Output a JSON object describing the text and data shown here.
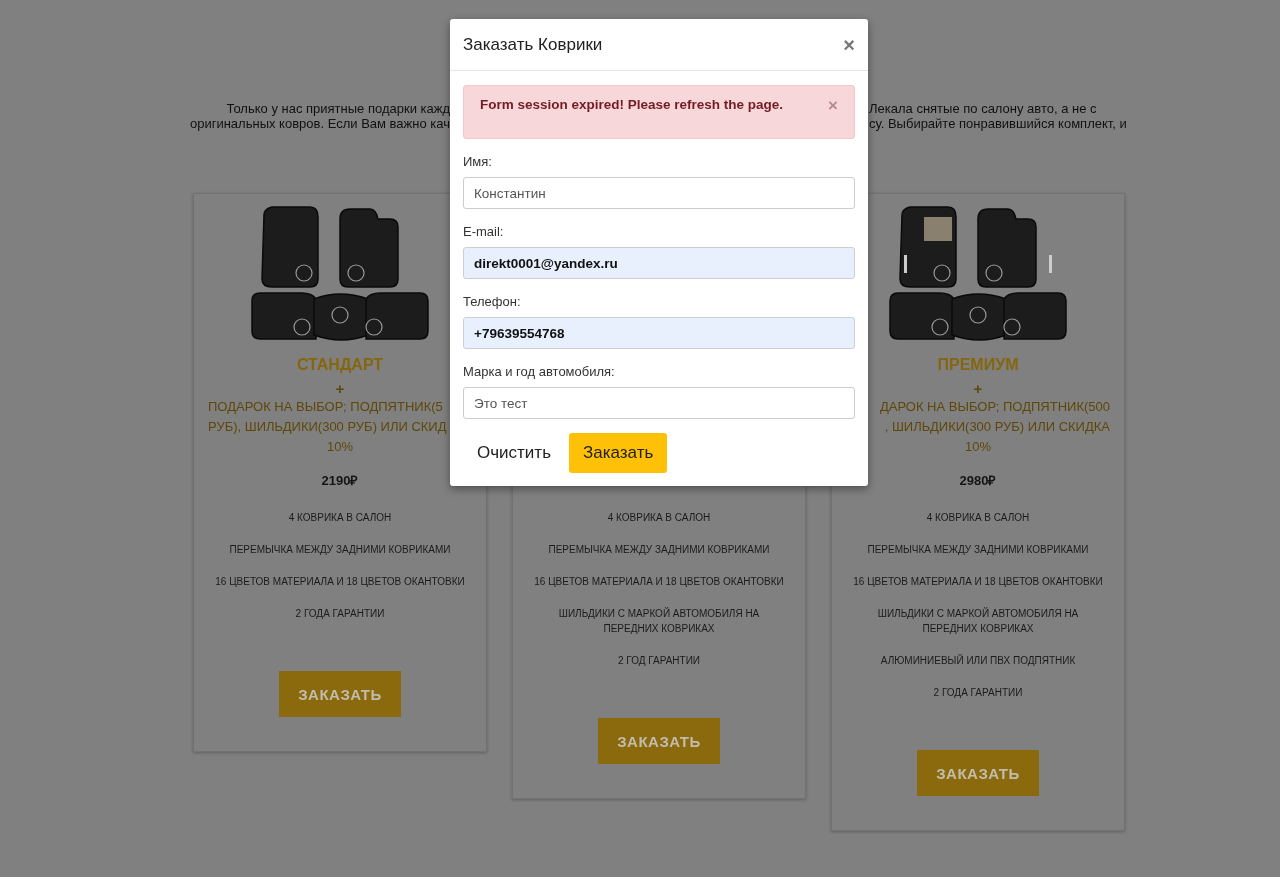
{
  "intro": {
    "left_lines": [
      "Только у нас приятные подарки кажд",
      "оригинальных ковров. Если Вам важно кач"
    ],
    "right_lines": [
      "Лекала снятые по салону авто, а не с",
      "су. Выбирайте понравившийся комплект, и"
    ]
  },
  "cards": [
    {
      "kind": "standard",
      "title": "СТАНДАРТ",
      "plus": "+",
      "clipped_right": true,
      "gift_lines": [
        "ПОДАРОК НА ВЫБОР; ПОДПЯТНИК(5",
        "РУБ), ШИЛЬДИКИ(300 РУБ) ИЛИ СКИД",
        "10%"
      ],
      "price": "2190₽",
      "features": [
        "4 КОВРИКА В САЛОН",
        "ПЕРЕМЫЧКА МЕЖДУ ЗАДНИМИ КОВРИКАМИ",
        "16 ЦВЕТОВ МАТЕРИАЛА И 18 ЦВЕТОВ ОКАНТОВКИ",
        "2 ГОДА ГАРАНТИИ"
      ],
      "button": "ЗАКАЗАТЬ"
    },
    {
      "kind": "hidden",
      "features": [
        "4 КОВРИКА В САЛОН",
        "ПЕРЕМЫЧКА МЕЖДУ ЗАДНИМИ КОВРИКАМИ",
        "16 ЦВЕТОВ МАТЕРИАЛА И 18 ЦВЕТОВ ОКАНТОВКИ",
        "ШИЛЬДИКИ С МАРКОЙ АВТОМОБИЛЯ НА ПЕРЕДНИХ КОВРИКАХ",
        "2 ГОД ГАРАНТИИ"
      ],
      "button": "ЗАКАЗАТЬ"
    },
    {
      "kind": "premium",
      "title": "ПРЕМИУМ",
      "plus": "+",
      "clipped_left": true,
      "gift_lines": [
        "ДАРОК НА ВЫБОР; ПОДПЯТНИК(500",
        ", ШИЛЬДИКИ(300 РУБ) ИЛИ СКИДКА",
        "10%"
      ],
      "price": "2980₽",
      "features": [
        "4 КОВРИКА В САЛОН",
        "ПЕРЕМЫЧКА МЕЖДУ ЗАДНИМИ КОВРИКАМИ",
        "16 ЦВЕТОВ МАТЕРИАЛА И 18 ЦВЕТОВ ОКАНТОВКИ",
        "ШИЛЬДИКИ С МАРКОЙ АВТОМОБИЛЯ НА ПЕРЕДНИХ КОВРИКАХ",
        "АЛЮМИНИЕВЫЙ ИЛИ ПВХ ПОДПЯТНИК",
        "2 ГОДА ГАРАНТИИ"
      ],
      "button": "ЗАКАЗАТЬ"
    }
  ],
  "modal": {
    "title": "Заказать Коврики",
    "close": "×",
    "alert": {
      "text": "Form session expired! Please refresh the page.",
      "close": "×"
    },
    "fields": [
      {
        "label": "Имя:",
        "value": "Константин",
        "autofilled": false
      },
      {
        "label": "E-mail:",
        "value": "direkt0001@yandex.ru",
        "autofilled": true
      },
      {
        "label": "Телефон:",
        "value": "+79639554768",
        "autofilled": true
      },
      {
        "label": "Марка и год автомобиля:",
        "value": "Это тест",
        "autofilled": false
      }
    ],
    "buttons": [
      {
        "label": "Очистить",
        "kind": "plain"
      },
      {
        "label": "Заказать",
        "kind": "primary"
      }
    ]
  }
}
